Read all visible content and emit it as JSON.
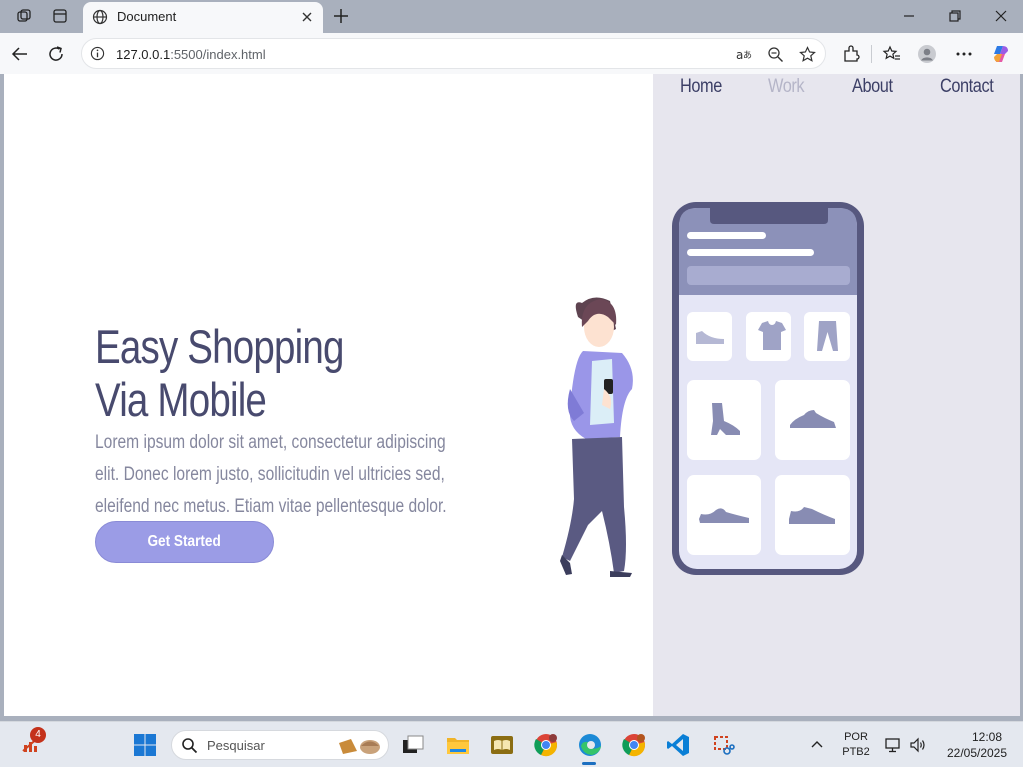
{
  "browser": {
    "tab_title": "Document",
    "url_host": "127.0.0.1",
    "url_rest": ":5500/index.html"
  },
  "site": {
    "nav": [
      "Home",
      "Work",
      "About",
      "Contact"
    ],
    "active_nav": "Work",
    "hero_title_line1": "Easy Shopping",
    "hero_title_line2": "Via Mobile",
    "hero_text": "Lorem ipsum dolor sit amet, consectetur adipiscing elit. Donec lorem justo, sollicitudin vel ultricies sed, eleifend nec metus. Etiam vitae pellentesque dolor.",
    "cta_label": "Get Started"
  },
  "taskbar": {
    "search_placeholder": "Pesquisar",
    "notification_count": "4",
    "lang_line1": "POR",
    "lang_line2": "PTB2",
    "time": "12:08",
    "date": "22/05/2025"
  },
  "colors": {
    "accent": "#9b9ce6",
    "title": "#484a6e",
    "panel": "#e7e6ee"
  }
}
